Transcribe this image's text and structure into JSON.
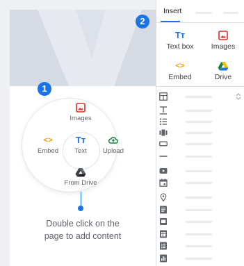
{
  "badges": {
    "one": "1",
    "two": "2"
  },
  "menu": {
    "images_label": "Images",
    "embed_label": "Embed",
    "text_label": "Text",
    "upload_label": "Upload",
    "drive_label": "From Drive",
    "text_glyph": "Tт",
    "embed_glyph": "<>"
  },
  "hint": {
    "line1": "Double click on the",
    "line2": "page to add content"
  },
  "panel": {
    "tab_label": "Insert",
    "items": {
      "textbox": {
        "label": "Text box",
        "glyph": "Tт"
      },
      "images": {
        "label": "Images"
      },
      "embed": {
        "label": "Embed",
        "glyph": "<>"
      },
      "drive": {
        "label": "Drive"
      }
    }
  },
  "colors": {
    "accent": "#1a73e8",
    "red": "#d93025",
    "green": "#188038",
    "orange": "#f29900"
  },
  "icons": [
    "image-icon",
    "embed-icon",
    "text-icon",
    "upload-icon",
    "drive-icon",
    "layouts-icon",
    "divider-icon",
    "list-icon",
    "carousel-icon",
    "button-icon",
    "line-icon",
    "youtube-icon",
    "calendar-icon",
    "map-pin-icon",
    "docs-icon",
    "slides-icon",
    "sheets-icon",
    "forms-icon",
    "charts-icon"
  ]
}
